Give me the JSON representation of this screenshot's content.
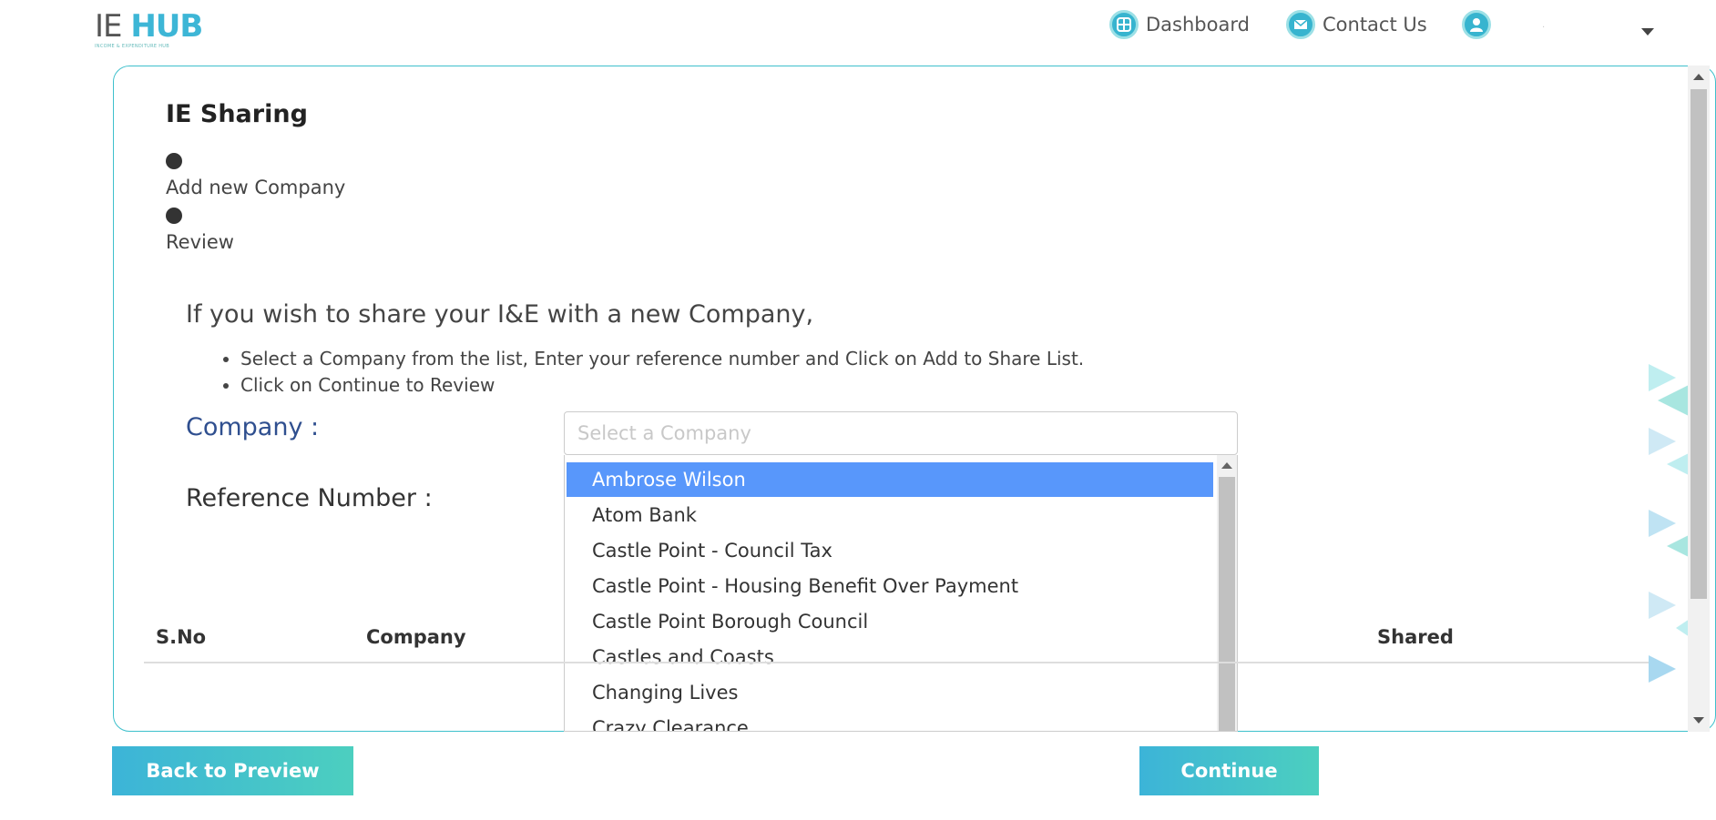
{
  "header": {
    "logo_main_a": "IE",
    "logo_main_b": "HUB",
    "logo_tagline": "INCOME & EXPENDITURE HUB",
    "nav": [
      {
        "label": "Dashboard",
        "icon": "dashboard-icon"
      },
      {
        "label": "Contact Us",
        "icon": "mail-icon"
      }
    ],
    "user_icon": "user-avatar-icon",
    "user_name": "."
  },
  "page": {
    "title": "IE Sharing",
    "steps": [
      "Add new Company",
      "Review"
    ],
    "intro": "If you wish to share your I&E with a new Company,",
    "bullets": [
      "Select a Company from the list, Enter your reference number and Click on Add to Share List.",
      "Click on Continue to Review"
    ],
    "company_label": "Company :",
    "reference_label": "Reference Number :",
    "select_placeholder": "Select a Company",
    "options": [
      "Ambrose Wilson",
      "Atom Bank",
      "Castle Point - Council Tax",
      "Castle Point - Housing Benefit Over Payment",
      "Castle Point Borough Council",
      "Castles and Coasts",
      "Changing Lives",
      "Crazy Clearance"
    ],
    "highlighted_option": "Ambrose Wilson",
    "table_headers": [
      "S.No",
      "Company",
      "Shared"
    ]
  },
  "buttons": {
    "back": "Back to Preview",
    "continue": "Continue"
  },
  "colors": {
    "accent": "#3db6d6",
    "highlight": "#5897fb",
    "label_blue": "#2f4f8f"
  }
}
